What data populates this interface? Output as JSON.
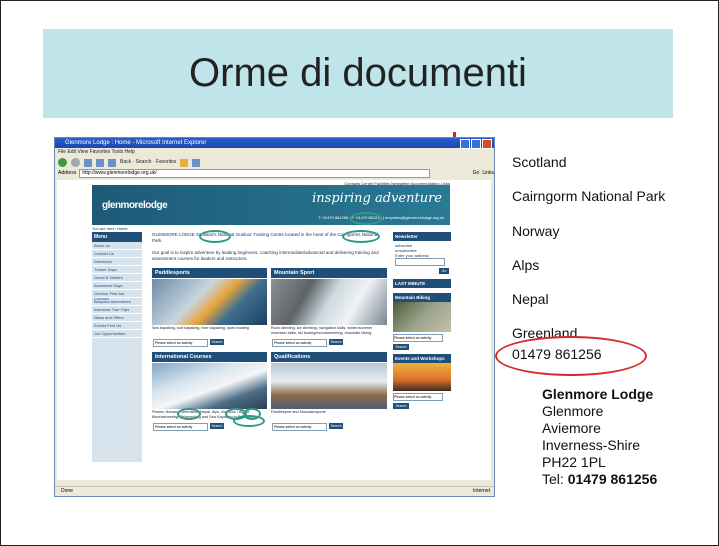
{
  "slide": {
    "title": "Orme di documenti"
  },
  "browser": {
    "window_title": "Glenmore Lodge : Home - Microsoft Internet Explorer",
    "menu": "File  Edit  View  Favorites  Tools  Help",
    "toolbar": "Back · Search · Favorites",
    "address_label": "Address",
    "url": "http://www.glenmorelodge.org.uk/",
    "go_label": "Go",
    "links_label": "Links",
    "status_left": "Done",
    "status_right": "Internet"
  },
  "website": {
    "logo": "glenmorelodge",
    "tagline": "inspiring adventure",
    "top_links": "Contacts  Centre Facilities  Newsletter  Accommodation  Links",
    "phone_line": "T: 01479 861256  |  F: 01479 861212  |  enquiries@glenmorelodge.org.uk",
    "breadcrumb": "You are here: Home",
    "menu_title": "Menu",
    "menu_items": [
      "About us",
      "Contact Us",
      "Directions",
      "Trainer Days",
      "Guest & Visitors",
      "Adventure Days",
      "Outdoor First Aid Courses",
      "Bespoke Adventures",
      "Instructor Tour Trips",
      "News and Offers",
      "Events Find Us",
      "Job Opportunities"
    ],
    "intro_text": "GLENMORE LODGE  Scotland's National Outdoor Training Centre located in the heart of the Cairngorms National Park.",
    "intro_text2": "Our goal is to inspire adventure by leading beginners, coaching intermediate/advanced and delivering training and assessment courses for leaders and instructors.",
    "panels": [
      {
        "title": "Paddlesports",
        "caption": "Sea kayaking, surf kayaking, river kayaking, open boating",
        "select": "Please select an activity",
        "button": "Search"
      },
      {
        "title": "Mountain Sport",
        "caption": "Rock climbing, ice climbing, navigation skills, winter/summer mountain skills, ski touring/mountaineering, mountain biking.",
        "select": "Please select an activity",
        "button": "Search"
      },
      {
        "title": "International Courses",
        "caption": "Places: Norway, Greenland, Nepal, Alps, Morocco / Alpine Mountaineering, Telemarking and Sea Kayaking in Greenland.",
        "select": "Please select an activity",
        "button": "Search"
      },
      {
        "title": "Qualifications",
        "caption": "Paddlesport and Mountainsports",
        "select": "Please select an activity",
        "button": "Search"
      }
    ],
    "right": {
      "newsletter": "Newsletter",
      "subscribe": "subscribe",
      "unsubscribe": "unsubscribe",
      "email_label": "Enter your address",
      "go": "Go",
      "last_minute": "LAST MINUTE AVAILABILITY",
      "mountain_biking": "Mountain Biking",
      "events": "Events and Workshops",
      "select": "Please select an activity",
      "search": "Search"
    }
  },
  "places": [
    "Scotland",
    "Cairngorm National Park",
    "Norway",
    "Alps",
    "Nepal",
    "Greenland"
  ],
  "phone": "01479 861256",
  "address": {
    "org": "Glenmore Lodge",
    "lines": [
      "Glenmore",
      "Aviemore",
      "Inverness-Shire",
      "PH22 1PL"
    ],
    "tel_label": "Tel: ",
    "tel_number": "01479 861256"
  },
  "colors": {
    "title_band": "#bfe4ea",
    "highlight_ellipse": "#d42a2a",
    "site_blue": "#1f4f79",
    "highlight_oval": "#2f9a86"
  }
}
